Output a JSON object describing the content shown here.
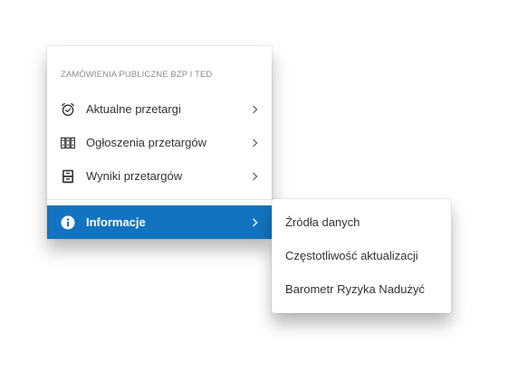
{
  "menu": {
    "header": "ZAMÓWIENIA PUBLICZNE BZP I TED",
    "items": [
      {
        "label": "Aktualne przetargi",
        "icon": "alarm-clock-icon"
      },
      {
        "label": "Ogłoszenia przetargów",
        "icon": "binders-icon"
      },
      {
        "label": "Wyniki przetargów",
        "icon": "file-cabinet-icon"
      }
    ],
    "active_item": {
      "label": "Informacje",
      "icon": "info-circle-icon"
    }
  },
  "submenu": {
    "items": [
      {
        "label": "Źródła danych"
      },
      {
        "label": "Częstotliwość aktualizacji"
      },
      {
        "label": "Barometr Ryzyka Nadużyć"
      }
    ]
  },
  "colors": {
    "active_background": "#1274c0",
    "active_text": "#ffffff",
    "text": "#333333",
    "header_text": "#8c8c8c"
  }
}
